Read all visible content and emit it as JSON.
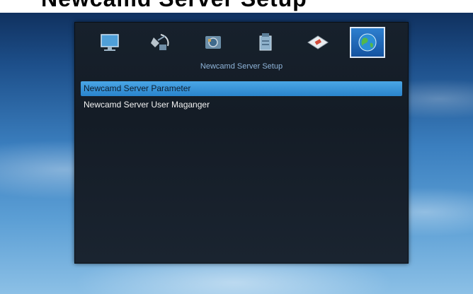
{
  "title_banner": {
    "text": "Newcamd Server Setup"
  },
  "icon_bar": {
    "icons": [
      {
        "name": "monitor-icon"
      },
      {
        "name": "satellite-icon"
      },
      {
        "name": "tools-icon"
      },
      {
        "name": "package-icon"
      },
      {
        "name": "card-icon"
      },
      {
        "name": "globe-icon",
        "active": true
      }
    ]
  },
  "section": {
    "title": "Newcamd Server Setup"
  },
  "menu": {
    "items": [
      {
        "label": "Newcamd Server Parameter",
        "selected": true
      },
      {
        "label": "Newcamd Server User Maganger",
        "selected": false
      }
    ]
  },
  "colors": {
    "selection": "#3a96dc",
    "active_icon_bg": "#1f69b8",
    "panel_bg": "#161f29"
  }
}
